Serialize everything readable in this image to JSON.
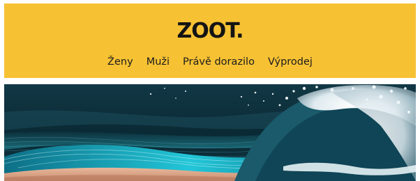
{
  "header": {
    "logo_text": "ZOOT.",
    "background_color": "#f6c133"
  },
  "nav": {
    "items": [
      {
        "label": "Ženy"
      },
      {
        "label": "Muži"
      },
      {
        "label": "Právě dorazilo"
      },
      {
        "label": "Výprodej"
      }
    ]
  },
  "hero": {
    "image": "ocean-wave-banner",
    "colors": {
      "sky": "#0b2530",
      "water": "#1fb3c7",
      "sand": "#d9a98c",
      "foam": "#eef3f6"
    }
  }
}
